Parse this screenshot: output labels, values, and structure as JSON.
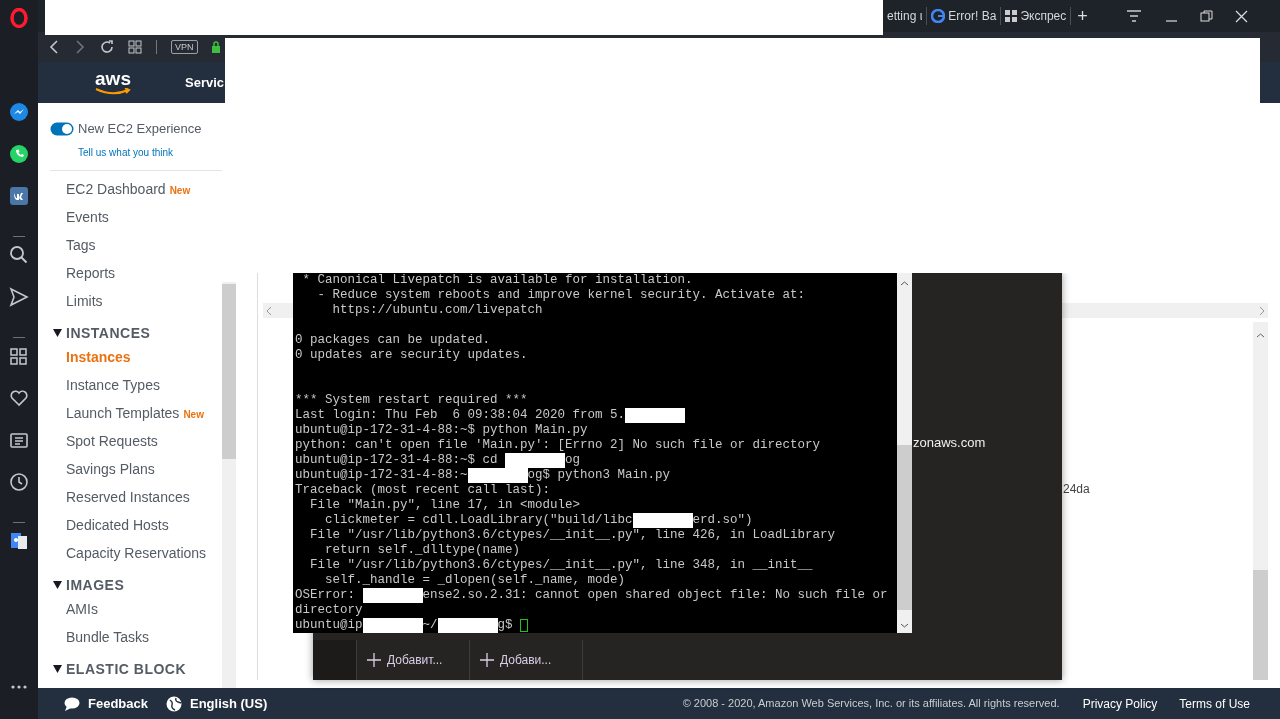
{
  "browser": {
    "tabs": [
      {
        "title": "etting ι",
        "selected": false
      },
      {
        "title": "Error! Ba",
        "selected": false
      },
      {
        "title": "Экспрес",
        "selected": false
      }
    ],
    "new_tab": "+",
    "vpn_badge": "VPN"
  },
  "aws_header": {
    "logo": "aws",
    "services": "Servic"
  },
  "sidebar": {
    "experience_toggle": {
      "label": "New EC2 Experience",
      "on": true
    },
    "feedback_link": "Tell us what you think",
    "items": [
      {
        "kind": "link",
        "label": "EC2 Dashboard",
        "badge": "New",
        "selected": false
      },
      {
        "kind": "link",
        "label": "Events",
        "selected": false
      },
      {
        "kind": "link",
        "label": "Tags",
        "selected": false
      },
      {
        "kind": "link",
        "label": "Reports",
        "selected": false
      },
      {
        "kind": "link",
        "label": "Limits",
        "selected": false
      },
      {
        "kind": "section",
        "label": "INSTANCES",
        "expanded": true,
        "children": [
          {
            "kind": "link",
            "label": "Instances",
            "selected": true
          },
          {
            "kind": "link",
            "label": "Instance Types",
            "selected": false
          },
          {
            "kind": "link",
            "label": "Launch Templates",
            "badge": "New",
            "selected": false
          },
          {
            "kind": "link",
            "label": "Spot Requests",
            "selected": false
          },
          {
            "kind": "link",
            "label": "Savings Plans",
            "selected": false
          },
          {
            "kind": "link",
            "label": "Reserved Instances",
            "selected": false
          },
          {
            "kind": "link",
            "label": "Dedicated Hosts",
            "selected": false
          },
          {
            "kind": "link",
            "label": "Capacity Reservations",
            "selected": false
          }
        ]
      },
      {
        "kind": "section",
        "label": "IMAGES",
        "expanded": true,
        "children": [
          {
            "kind": "link",
            "label": "AMIs",
            "selected": false
          },
          {
            "kind": "link",
            "label": "Bundle Tasks",
            "selected": false
          }
        ]
      },
      {
        "kind": "section",
        "label": "ELASTIC BLOCK",
        "expanded": true
      }
    ]
  },
  "content": {
    "dns_fragment": "zonaws.com",
    "id_fragment": "24da"
  },
  "console_window": {
    "buttons": [
      {
        "label": "Добавит..."
      },
      {
        "label": "Добави..."
      }
    ]
  },
  "terminal": {
    "lines": [
      {
        "kind": "text",
        "segments": [
          {
            "kind": "text",
            "text": " * Canonical Livepatch is available for installation."
          }
        ]
      },
      {
        "kind": "text",
        "segments": [
          {
            "kind": "text",
            "text": "   - Reduce system reboots and improve kernel security. Activate at:"
          }
        ]
      },
      {
        "kind": "text",
        "segments": [
          {
            "kind": "text",
            "text": "     https://ubuntu.com/livepatch"
          }
        ]
      },
      {
        "kind": "blank"
      },
      {
        "kind": "text",
        "segments": [
          {
            "kind": "text",
            "text": "0 packages can be updated."
          }
        ]
      },
      {
        "kind": "text",
        "segments": [
          {
            "kind": "text",
            "text": "0 updates are security updates."
          }
        ]
      },
      {
        "kind": "blank"
      },
      {
        "kind": "blank"
      },
      {
        "kind": "text",
        "segments": [
          {
            "kind": "text",
            "text": "*** System restart required ***"
          }
        ]
      },
      {
        "kind": "text",
        "segments": [
          {
            "kind": "text",
            "text": "Last login: Thu Feb  6 09:38:04 2020 from 5."
          },
          {
            "kind": "redaction"
          }
        ]
      },
      {
        "kind": "text",
        "segments": [
          {
            "kind": "text",
            "text": "ubuntu@ip-172-31-4-88:~$ python Main.py"
          }
        ]
      },
      {
        "kind": "text",
        "segments": [
          {
            "kind": "text",
            "text": "python: can't open file 'Main.py': [Errno 2] No such file or directory"
          }
        ]
      },
      {
        "kind": "text",
        "segments": [
          {
            "kind": "text",
            "text": "ubuntu@ip-172-31-4-88:~$ cd "
          },
          {
            "kind": "redaction"
          },
          {
            "kind": "text",
            "text": "og"
          }
        ]
      },
      {
        "kind": "text",
        "segments": [
          {
            "kind": "text",
            "text": "ubuntu@ip-172-31-4-88:~"
          },
          {
            "kind": "redaction"
          },
          {
            "kind": "text",
            "text": "og$ python3 Main.py"
          }
        ]
      },
      {
        "kind": "text",
        "segments": [
          {
            "kind": "text",
            "text": "Traceback (most recent call last):"
          }
        ]
      },
      {
        "kind": "text",
        "segments": [
          {
            "kind": "text",
            "text": "  File \"Main.py\", line 17, in <module>"
          }
        ]
      },
      {
        "kind": "text",
        "segments": [
          {
            "kind": "text",
            "text": "    clickmeter = cdll.LoadLibrary(\"build/libc"
          },
          {
            "kind": "redaction"
          },
          {
            "kind": "text",
            "text": "erd.so\")"
          }
        ]
      },
      {
        "kind": "text",
        "segments": [
          {
            "kind": "text",
            "text": "  File \"/usr/lib/python3.6/ctypes/__init__.py\", line 426, in LoadLibrary"
          }
        ]
      },
      {
        "kind": "text",
        "segments": [
          {
            "kind": "text",
            "text": "    return self._dlltype(name)"
          }
        ]
      },
      {
        "kind": "text",
        "segments": [
          {
            "kind": "text",
            "text": "  File \"/usr/lib/python3.6/ctypes/__init__.py\", line 348, in __init__"
          }
        ]
      },
      {
        "kind": "text",
        "segments": [
          {
            "kind": "text",
            "text": "    self._handle = _dlopen(self._name, mode)"
          }
        ]
      },
      {
        "kind": "text",
        "segments": [
          {
            "kind": "text",
            "text": "OSError: "
          },
          {
            "kind": "redaction"
          },
          {
            "kind": "text",
            "text": "ense2.so.2.31: cannot open shared object file: No such file or"
          }
        ]
      },
      {
        "kind": "text",
        "segments": [
          {
            "kind": "text",
            "text": "directory"
          }
        ]
      },
      {
        "kind": "text",
        "segments": [
          {
            "kind": "text",
            "text": "ubuntu@ip"
          },
          {
            "kind": "redaction"
          },
          {
            "kind": "text",
            "text": "~/"
          },
          {
            "kind": "redaction"
          },
          {
            "kind": "text",
            "text": "g$"
          }
        ]
      }
    ]
  },
  "footer": {
    "feedback": "Feedback",
    "language": "English (US)",
    "copyright": "© 2008 - 2020, Amazon Web Services, Inc. or its affiliates. All rights reserved.",
    "links": [
      "Privacy Policy",
      "Terms of Use"
    ]
  }
}
